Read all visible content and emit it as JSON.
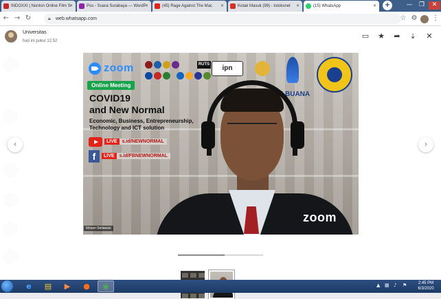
{
  "browser": {
    "tabs": [
      {
        "label": "INDOXXI | Nonton Online Film S",
        "icon": "film-icon",
        "color": "#c62828"
      },
      {
        "label": "Pos - Suara Surabaya — WordP",
        "icon": "wordpress-icon",
        "color": "#8e24aa"
      },
      {
        "label": "(45) Rage Against The Mac",
        "icon": "youtube-icon",
        "color": "#e62117"
      },
      {
        "label": "Kotak Masuk (99) - totoksnet",
        "icon": "gmail-icon",
        "color": "#d93025"
      },
      {
        "label": "(15) WhatsApp",
        "icon": "whatsapp-icon",
        "color": "#25d366"
      }
    ],
    "new_tab_label": "+",
    "url": "web.whatsapp.com",
    "window_controls": {
      "minimize": "—",
      "maximize": "❐",
      "close": "✕"
    }
  },
  "viewer": {
    "sender": "Universitas",
    "timestamp": "hari ini pukul 12.52",
    "actions": {
      "message": "message-icon",
      "star": "star-icon",
      "forward": "forward-icon",
      "download": "download-icon",
      "close": "close-icon"
    },
    "prev_arrow": "‹",
    "next_arrow": "›",
    "progress": 0.55
  },
  "poster": {
    "zoom_brand": "zoom",
    "badge": "Online Meeting",
    "title_line1": "COVID19",
    "title_line2": "and New Normal",
    "topics": "Economic, Business, Entrepreneurship, Technology and ICT solution",
    "youtube_live": "LIVE",
    "youtube_link": "s.id/NEWNORMAL",
    "facebook_live": "LIVE",
    "facebook_link": "s.id/FBNEWNORMAL",
    "ruts": "RUTS",
    "ipn": "ipn",
    "uni_partial": "U BUANA",
    "zoom_watermark": "zoom",
    "speaker": "Ikhsan Setiawan"
  },
  "taskbar": {
    "time": "2:45 PM",
    "date": "6/3/2020",
    "apps": [
      "ie-icon",
      "explorer-icon",
      "media-player-icon",
      "firefox-icon",
      "chrome-icon"
    ]
  }
}
